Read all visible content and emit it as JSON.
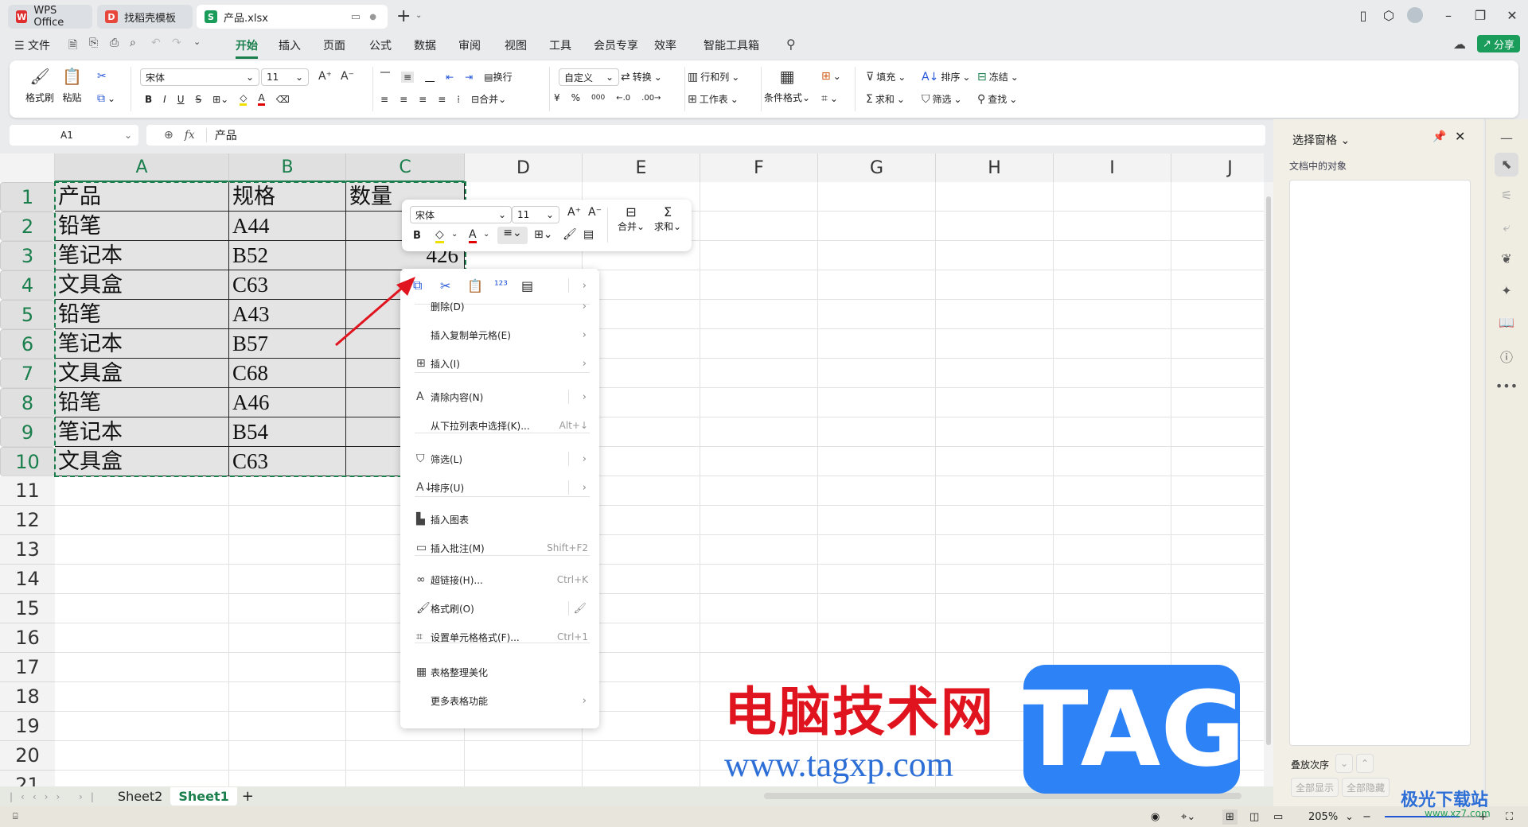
{
  "tabs": [
    {
      "label": "WPS Office",
      "icon": "wps-logo-icon",
      "color": "#e02e2e"
    },
    {
      "label": "找稻壳模板",
      "icon": "docer-icon",
      "color": "#e8473c"
    },
    {
      "label": "产品.xlsx",
      "icon": "spreadsheet-icon",
      "color": "#1a9c5b"
    }
  ],
  "menu": {
    "file": "文件",
    "tabs": [
      "开始",
      "插入",
      "页面",
      "公式",
      "数据",
      "审阅",
      "视图",
      "工具",
      "会员专享",
      "效率",
      "智能工具箱"
    ],
    "active": "开始",
    "share": "分享"
  },
  "ribbon": {
    "format_painter": "格式刷",
    "paste": "粘贴",
    "font": "宋体",
    "size": "11",
    "wrap": "换行",
    "merge": "合并",
    "number_format": "自定义",
    "convert": "转换",
    "rows_cols": "行和列",
    "worksheet": "工作表",
    "cond_format": "条件格式",
    "fill": "填充",
    "sort": "排序",
    "freeze": "冻结",
    "sum": "求和",
    "filter": "筛选",
    "find": "查找",
    "bold": "B",
    "italic": "I",
    "underline": "U",
    "strike": "S",
    "currency": "¥",
    "percent": "%",
    "thousands": "000"
  },
  "formula_bar": {
    "name_box": "A1",
    "fx": "fx",
    "value": "产品"
  },
  "grid": {
    "columns": [
      "A",
      "B",
      "C",
      "D",
      "E",
      "F",
      "G",
      "H",
      "I",
      "J"
    ],
    "rows": [
      "1",
      "2",
      "3",
      "4",
      "5",
      "6",
      "7",
      "8",
      "9",
      "10",
      "11",
      "12",
      "13",
      "14",
      "15",
      "16",
      "17",
      "18",
      "19",
      "20",
      "21"
    ],
    "cells": [
      [
        "产品",
        "规格",
        "数量"
      ],
      [
        "铅笔",
        "A44",
        ""
      ],
      [
        "笔记本",
        "B52",
        "426"
      ],
      [
        "文具盒",
        "C63",
        ""
      ],
      [
        "铅笔",
        "A43",
        ""
      ],
      [
        "笔记本",
        "B57",
        ""
      ],
      [
        "文具盒",
        "C68",
        ""
      ],
      [
        "铅笔",
        "A46",
        ""
      ],
      [
        "笔记本",
        "B54",
        ""
      ],
      [
        "文具盒",
        "C63",
        ""
      ]
    ],
    "selection": "A1:C10"
  },
  "mini_toolbar": {
    "font": "宋体",
    "size": "11",
    "bold": "B",
    "merge": "合并",
    "sum": "求和"
  },
  "context_menu": {
    "items": [
      {
        "label": "删除(D)",
        "icon": "",
        "shortcut": "",
        "submenu": true
      },
      {
        "label": "插入复制单元格(E)",
        "icon": "",
        "shortcut": "",
        "submenu": true
      },
      {
        "label": "插入(I)",
        "icon": "insert-icon",
        "shortcut": "",
        "submenu": true
      },
      {
        "label": "清除内容(N)",
        "icon": "clear-icon",
        "shortcut": "",
        "submenu": true
      },
      {
        "label": "从下拉列表中选择(K)...",
        "icon": "",
        "shortcut": "Alt+↓",
        "submenu": false
      },
      {
        "label": "筛选(L)",
        "icon": "filter-icon",
        "shortcut": "",
        "submenu": true
      },
      {
        "label": "排序(U)",
        "icon": "sort-icon",
        "shortcut": "",
        "submenu": true
      },
      {
        "label": "插入图表",
        "icon": "chart-icon",
        "shortcut": "",
        "submenu": false
      },
      {
        "label": "插入批注(M)",
        "icon": "comment-icon",
        "shortcut": "Shift+F2",
        "submenu": false
      },
      {
        "label": "超链接(H)...",
        "icon": "link-icon",
        "shortcut": "Ctrl+K",
        "submenu": false
      },
      {
        "label": "格式刷(O)",
        "icon": "format-painter-icon",
        "shortcut": "",
        "submenu": false
      },
      {
        "label": "设置单元格格式(F)...",
        "icon": "cell-format-icon",
        "shortcut": "Ctrl+1",
        "submenu": false
      },
      {
        "label": "表格整理美化",
        "icon": "table-beautify-icon",
        "shortcut": "",
        "submenu": false
      },
      {
        "label": "更多表格功能",
        "icon": "",
        "shortcut": "",
        "submenu": true
      }
    ]
  },
  "panel": {
    "title": "选择窗格",
    "subtitle": "文档中的对象",
    "order": "叠放次序",
    "show_all": "全部显示",
    "hide_all": "全部隐藏"
  },
  "sheets": {
    "tabs": [
      "Sheet2",
      "Sheet1"
    ],
    "active": "Sheet1"
  },
  "status": {
    "zoom": "205%",
    "zoom_level": 0.72
  },
  "watermarks": {
    "cn": "电脑技术网",
    "url": "www.tagxp.com",
    "tag": "TAG",
    "site": "极光下载站",
    "site_url": "www.xz7.com"
  },
  "colors": {
    "accent": "#1a7f4d",
    "selection_fill": "#e4e4e4",
    "tag_blue": "#2d82f5",
    "watermark_red": "#e0141e"
  }
}
